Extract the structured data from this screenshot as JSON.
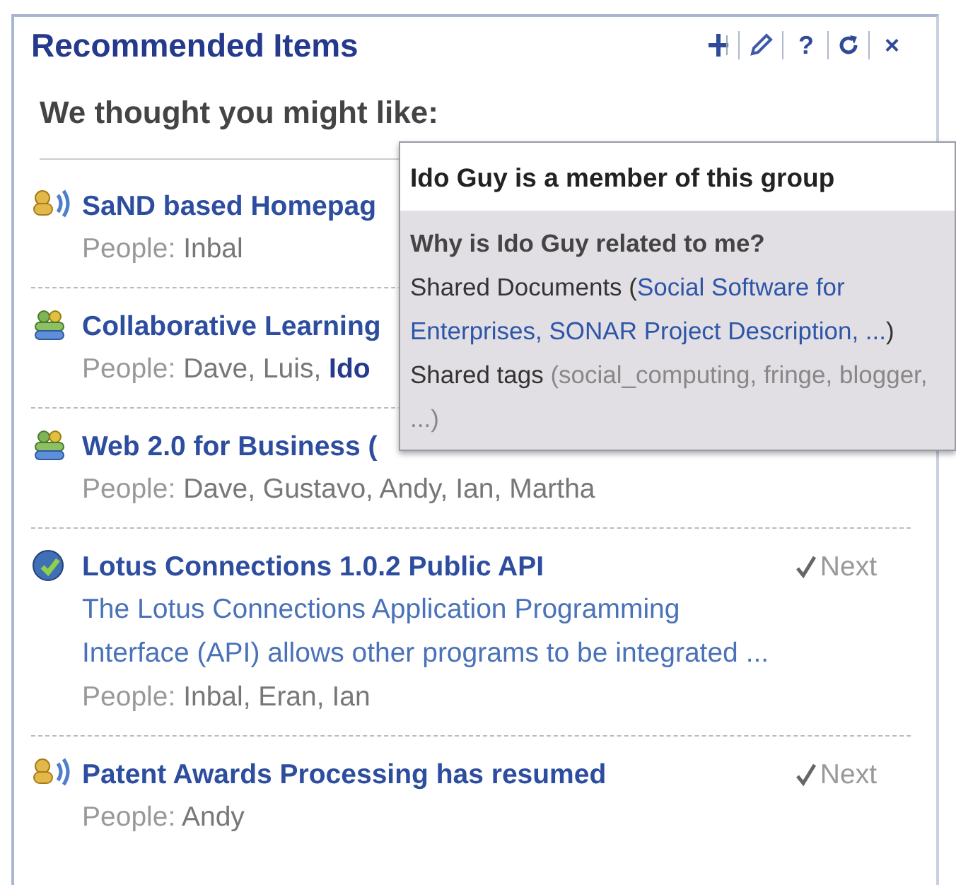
{
  "panel": {
    "title": "Recommended Items",
    "toolbar": [
      {
        "kind": "move"
      },
      {
        "kind": "edit"
      },
      {
        "kind": "help",
        "label": "?"
      },
      {
        "kind": "refresh"
      },
      {
        "kind": "close",
        "label": "×"
      }
    ],
    "heading": "We thought you might like:"
  },
  "items": [
    {
      "kind": "feed",
      "title": "SaND based Homepag",
      "people_label": "People:",
      "people": "Inbal"
    },
    {
      "kind": "community",
      "title": "Collaborative Learning",
      "people_label": "People:",
      "people": "Dave, Luis, **Ido**"
    },
    {
      "kind": "community",
      "title": "Web 2.0 for Business (",
      "people_label": "People:",
      "people": "Dave, Gustavo, Andy, Ian, Martha"
    },
    {
      "kind": "globe",
      "title": "Lotus Connections 1.0.2 Public API",
      "next": "Next",
      "description": "The Lotus Connections Application Programming Interface (API) allows other programs to be integrated ...",
      "people_label": "People:",
      "people": "Inbal, Eran, Ian"
    },
    {
      "kind": "feed",
      "title": "Patent Awards Processing has resumed",
      "next": "Next",
      "people_label": "People:",
      "people": "Andy"
    }
  ],
  "tooltip": {
    "title": "Ido Guy is a member of this group",
    "question": "Why is Ido Guy related to me?",
    "documents": {
      "label": "Shared Documents (",
      "links": "Social Software for Enterprises, SONAR Project Description, ...",
      "tail": ")"
    },
    "tags": {
      "label": "Shared tags",
      "text": "(social_computing, fringe, blogger, ...)"
    }
  }
}
